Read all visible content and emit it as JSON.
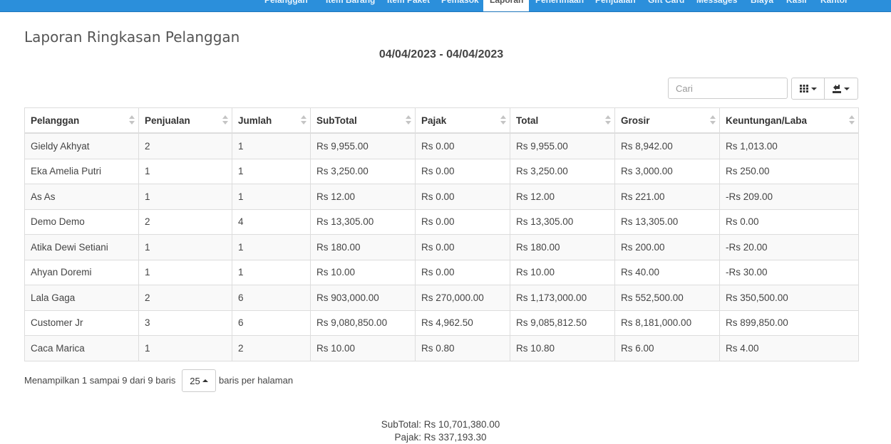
{
  "nav": {
    "items": [
      {
        "label": "Pelanggan",
        "width": 86
      },
      {
        "label": "Item Barang",
        "width": 86
      },
      {
        "label": "Item Paket",
        "width": 76
      },
      {
        "label": "Pemasok",
        "width": 68
      },
      {
        "label": "Laporan",
        "width": 64,
        "active": true
      },
      {
        "label": "Penerimaan",
        "width": 84
      },
      {
        "label": "Penjualan",
        "width": 74
      },
      {
        "label": "Gift Card",
        "width": 68
      },
      {
        "label": "Messages",
        "width": 76
      },
      {
        "label": "Biaya",
        "width": 50
      },
      {
        "label": "Kasir",
        "width": 48
      },
      {
        "label": "Kantor",
        "width": 52
      }
    ]
  },
  "page": {
    "title": "Laporan Ringkasan Pelanggan",
    "date_range": "04/04/2023 - 04/04/2023"
  },
  "toolbar": {
    "search_placeholder": "Cari",
    "columns_icon": "grid-icon",
    "export_icon": "export-icon"
  },
  "table": {
    "headers": [
      "Pelanggan",
      "Penjualan",
      "Jumlah",
      "SubTotal",
      "Pajak",
      "Total",
      "Grosir",
      "Keuntungan/Laba"
    ],
    "rows": [
      [
        "Gieldy Akhyat",
        "2",
        "1",
        "Rs 9,955.00",
        "Rs 0.00",
        "Rs 9,955.00",
        "Rs 8,942.00",
        "Rs 1,013.00"
      ],
      [
        "Eka Amelia Putri",
        "1",
        "1",
        "Rs 3,250.00",
        "Rs 0.00",
        "Rs 3,250.00",
        "Rs 3,000.00",
        "Rs 250.00"
      ],
      [
        "As As",
        "1",
        "1",
        "Rs 12.00",
        "Rs 0.00",
        "Rs 12.00",
        "Rs 221.00",
        "-Rs 209.00"
      ],
      [
        "Demo Demo",
        "2",
        "4",
        "Rs 13,305.00",
        "Rs 0.00",
        "Rs 13,305.00",
        "Rs 13,305.00",
        "Rs 0.00"
      ],
      [
        "Atika Dewi Setiani",
        "1",
        "1",
        "Rs 180.00",
        "Rs 0.00",
        "Rs 180.00",
        "Rs 200.00",
        "-Rs 20.00"
      ],
      [
        "Ahyan Doremi",
        "1",
        "1",
        "Rs 10.00",
        "Rs 0.00",
        "Rs 10.00",
        "Rs 40.00",
        "-Rs 30.00"
      ],
      [
        "Lala Gaga",
        "2",
        "6",
        "Rs 903,000.00",
        "Rs 270,000.00",
        "Rs 1,173,000.00",
        "Rs 552,500.00",
        "Rs 350,500.00"
      ],
      [
        "Customer Jr",
        "3",
        "6",
        "Rs 9,080,850.00",
        "Rs 4,962.50",
        "Rs 9,085,812.50",
        "Rs 8,181,000.00",
        "Rs 899,850.00"
      ],
      [
        "Caca Marica",
        "1",
        "2",
        "Rs 10.00",
        "Rs 0.80",
        "Rs 10.80",
        "Rs 6.00",
        "Rs 4.00"
      ]
    ]
  },
  "pagination": {
    "info": "Menampilkan 1 sampai 9 dari 9 baris",
    "page_size": "25",
    "per_page_label": "baris per halaman"
  },
  "summary": {
    "subtotal": "SubTotal: Rs 10,701,380.00",
    "tax": "Pajak: Rs 337,193.30"
  }
}
